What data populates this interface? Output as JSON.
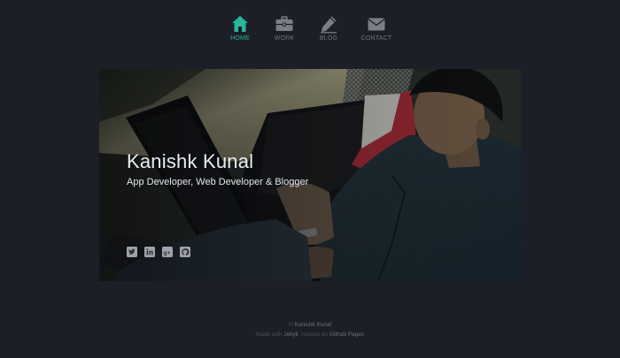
{
  "nav": {
    "items": [
      {
        "label": "HOME",
        "icon": "home-icon",
        "active": true
      },
      {
        "label": "WORK",
        "icon": "briefcase-icon",
        "active": false
      },
      {
        "label": "BLOG",
        "icon": "pencil-icon",
        "active": false
      },
      {
        "label": "CONTACT",
        "icon": "envelope-icon",
        "active": false
      }
    ]
  },
  "hero": {
    "name": "Kanishk Kunal",
    "tagline": "App Developer, Web Developer & Blogger",
    "socials": [
      {
        "icon": "twitter-icon"
      },
      {
        "icon": "linkedin-icon"
      },
      {
        "icon": "google-plus-icon"
      },
      {
        "icon": "github-icon"
      }
    ]
  },
  "footer": {
    "copyright_symbol": "©",
    "copyright_name": "Kanishk Kunal",
    "made_with": "Made with",
    "jekyll": "Jekyll",
    "hosted_on": ". Hosted on",
    "github_pages": "Github Pages"
  },
  "colors": {
    "background": "#1c1f27",
    "accent": "#2bb59a",
    "nav_inactive": "#6f737a"
  }
}
